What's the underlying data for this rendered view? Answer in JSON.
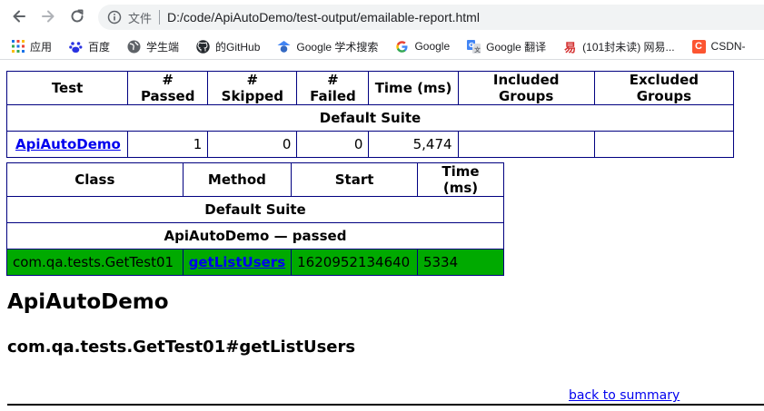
{
  "browser": {
    "scheme_label": "文件",
    "url": "D:/code/ApiAutoDemo/test-output/emailable-report.html",
    "bookmarks": [
      {
        "label": "应用",
        "icon": "apps-grid-icon"
      },
      {
        "label": "百度",
        "icon": "baidu-paw-icon"
      },
      {
        "label": "学生端",
        "icon": "globe-icon"
      },
      {
        "label": "的GitHub",
        "icon": "github-icon"
      },
      {
        "label": "Google 学术搜索",
        "icon": "google-scholar-icon"
      },
      {
        "label": "Google",
        "icon": "google-g-icon"
      },
      {
        "label": "Google 翻译",
        "icon": "google-translate-icon"
      },
      {
        "label": "(101封未读) 网易...",
        "icon": "netease-mail-icon"
      },
      {
        "label": "CSDN-",
        "icon": "csdn-icon"
      }
    ]
  },
  "summary_table": {
    "headers": [
      "Test",
      "# Passed",
      "# Skipped",
      "# Failed",
      "Time (ms)",
      "Included Groups",
      "Excluded Groups"
    ],
    "suite_label": "Default Suite",
    "row": {
      "test": "ApiAutoDemo",
      "passed": "1",
      "skipped": "0",
      "failed": "0",
      "time": "5,474",
      "included": "",
      "excluded": ""
    }
  },
  "methods_table": {
    "headers": [
      "Class",
      "Method",
      "Start",
      "Time (ms)"
    ],
    "suite_label": "Default Suite",
    "group_label": "ApiAutoDemo — passed",
    "row": {
      "class": "com.qa.tests.GetTest01",
      "method": "getListUsers",
      "start": "1620952134640",
      "time": "5334"
    }
  },
  "detail": {
    "test_title": "ApiAutoDemo",
    "method_title": "com.qa.tests.GetTest01#getListUsers",
    "back_link": "back to summary"
  },
  "colors": {
    "passed_row": "#00aa00",
    "table_border": "#000080",
    "link": "#0000ee"
  }
}
